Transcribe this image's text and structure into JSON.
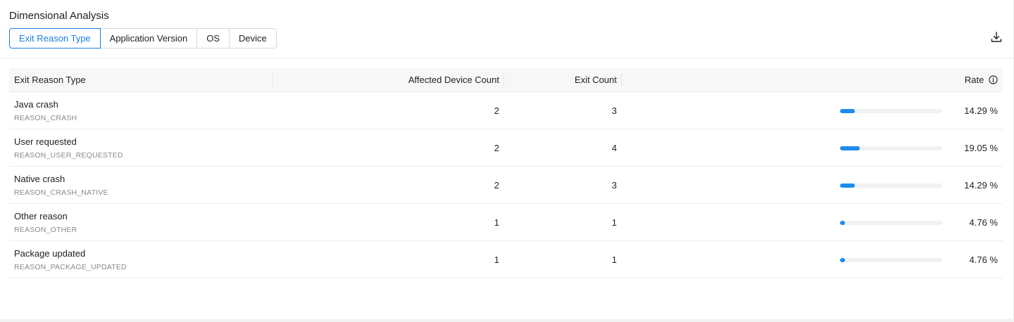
{
  "title": "Dimensional Analysis",
  "tabs": [
    {
      "label": "Exit Reason Type",
      "active": true
    },
    {
      "label": "Application Version",
      "active": false
    },
    {
      "label": "OS",
      "active": false
    },
    {
      "label": "Device",
      "active": false
    }
  ],
  "toolbar": {
    "download_icon": "download-icon"
  },
  "table": {
    "headers": {
      "type": "Exit Reason Type",
      "affected": "Affected Device Count",
      "exits": "Exit Count",
      "rate": "Rate"
    },
    "rate_info_icon": "info-icon",
    "rows": [
      {
        "name": "Java crash",
        "code": "REASON_CRASH",
        "affected": "2",
        "exits": "3",
        "rate": "14.29 %",
        "rate_value": 14.29
      },
      {
        "name": "User requested",
        "code": "REASON_USER_REQUESTED",
        "affected": "2",
        "exits": "4",
        "rate": "19.05 %",
        "rate_value": 19.05
      },
      {
        "name": "Native crash",
        "code": "REASON_CRASH_NATIVE",
        "affected": "2",
        "exits": "3",
        "rate": "14.29 %",
        "rate_value": 14.29
      },
      {
        "name": "Other reason",
        "code": "REASON_OTHER",
        "affected": "1",
        "exits": "1",
        "rate": "4.76 %",
        "rate_value": 4.76
      },
      {
        "name": "Package updated",
        "code": "REASON_PACKAGE_UPDATED",
        "affected": "1",
        "exits": "1",
        "rate": "4.76 %",
        "rate_value": 4.76
      }
    ]
  },
  "colors": {
    "accent": "#1b7fe0",
    "bar_fill": "#1f8ceb",
    "bar_track": "#f0f1f3"
  }
}
